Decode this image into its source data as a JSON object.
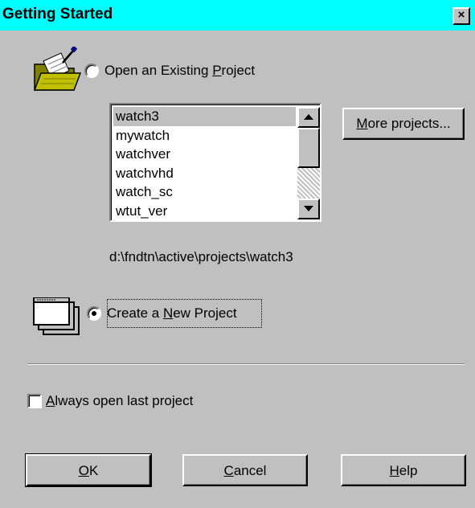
{
  "window": {
    "title": "Getting Started",
    "close_glyph": "×"
  },
  "open_existing": {
    "label_pre": "Open an Existing ",
    "label_accel": "P",
    "label_post": "roject",
    "selected": false
  },
  "project_list": {
    "items": [
      "watch3",
      "mywatch",
      "watchver",
      "watchvhd",
      "watch_sc",
      "wtut_ver"
    ],
    "selected_index": 0
  },
  "more_projects_button": {
    "accel": "M",
    "rest": "ore projects..."
  },
  "project_path": "d:\\fndtn\\active\\projects\\watch3",
  "create_new": {
    "label_pre": "Create a ",
    "label_accel": "N",
    "label_post": "ew Project",
    "selected": true
  },
  "always_open_last": {
    "label_accel": "A",
    "label_post": "lways open last project",
    "checked": false
  },
  "buttons": {
    "ok": {
      "accel": "O",
      "rest": "K"
    },
    "cancel": {
      "accel": "C",
      "rest": "ancel"
    },
    "help": {
      "accel": "H",
      "rest": "elp"
    }
  },
  "icons": {
    "open_folder": "open-folder-icon",
    "new_project": "new-project-icon"
  },
  "colors": {
    "title_bar": "#00ffff",
    "dialog_face": "#c0c0c0"
  }
}
